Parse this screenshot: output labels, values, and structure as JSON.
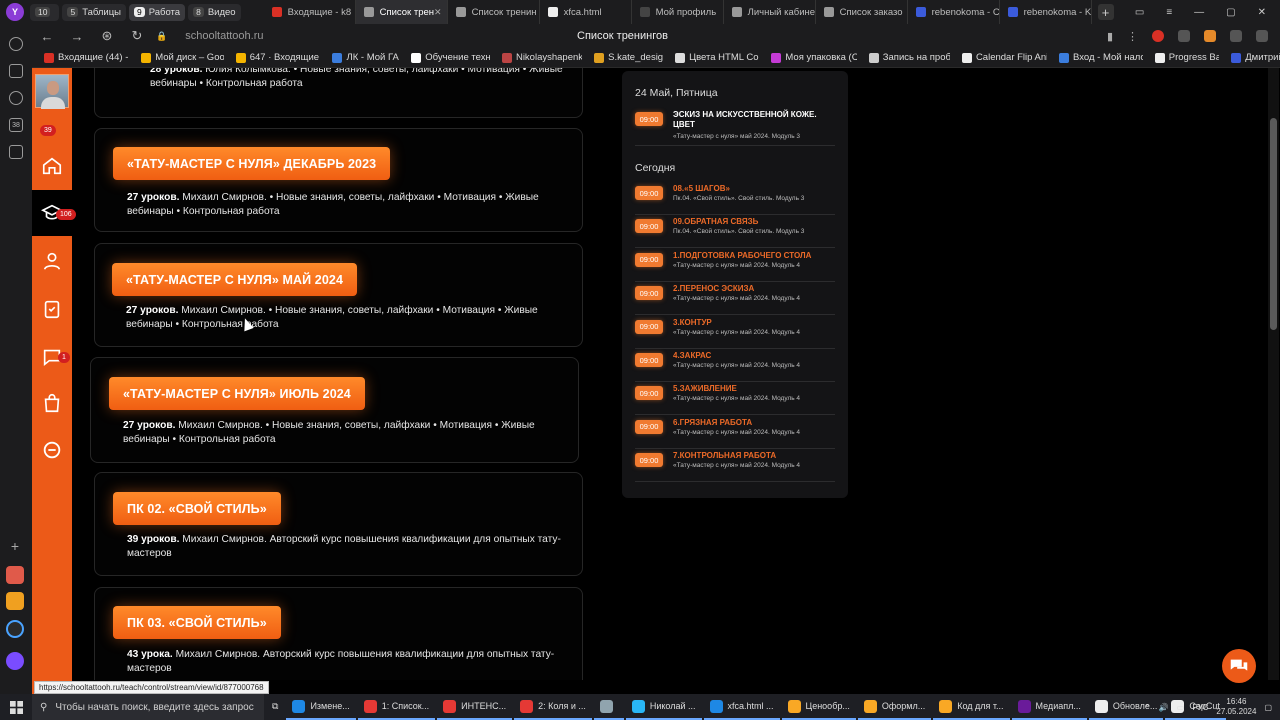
{
  "browser": {
    "tab_groups": [
      {
        "count": "10",
        "label": "Таблицы"
      },
      {
        "count": "5",
        "label": "Таблицы"
      },
      {
        "count": "9",
        "label": "Работа"
      },
      {
        "count": "8",
        "label": "Видео"
      }
    ],
    "tabs": [
      {
        "label": "Входящие - k8",
        "icon_color": "#d93025"
      },
      {
        "label": "Список трен",
        "icon_color": "#999999",
        "active": true
      },
      {
        "label": "Список тренин",
        "icon_color": "#999999"
      },
      {
        "label": "xfca.html",
        "icon_color": "#eeeeee"
      },
      {
        "label": "Мой профиль",
        "icon_color": "#444444"
      },
      {
        "label": "Личный кабине",
        "icon_color": "#999999"
      },
      {
        "label": "Список заказо",
        "icon_color": "#999999"
      },
      {
        "label": "rebenokoma - C",
        "icon_color": "#3b5bdb"
      },
      {
        "label": "rebenokoma - K",
        "icon_color": "#3b5bdb"
      }
    ],
    "url": "schooltattooh.ru",
    "page_title": "Список тренингов",
    "bookmarks": [
      {
        "label": "Входящие (44) - k",
        "color": "#d93025"
      },
      {
        "label": "Мой диск – Goog",
        "color": "#f4b400"
      },
      {
        "label": "647 · Входящие –",
        "color": "#f4b400"
      },
      {
        "label": "ЛК - Мой ГАЗ",
        "color": "#3b7ddd"
      },
      {
        "label": "Обучение техни",
        "color": "#ffffff"
      },
      {
        "label": "Nikolayshapenko",
        "color": "#bb4444"
      },
      {
        "label": "S.kate_design",
        "color": "#e0a020"
      },
      {
        "label": "Цвета HTML Colo",
        "color": "#dddddd"
      },
      {
        "label": "Моя упаковка (Сс",
        "color": "#c53bd6"
      },
      {
        "label": "Запись на пробн",
        "color": "#cccccc"
      },
      {
        "label": "Calendar Flip Anin",
        "color": "#eeeeee"
      },
      {
        "label": "Вход - Мой налог",
        "color": "#3b7ddd"
      },
      {
        "label": "Progress Bar",
        "color": "#eeeeee"
      },
      {
        "label": "Дмитрий",
        "color": "#3b5bdb"
      }
    ]
  },
  "sidebar": {
    "badges": {
      "top": "39",
      "courses": "106",
      "chat": "1"
    }
  },
  "courses": [
    {
      "title": "",
      "lessons": "28 уроков.",
      "text": "Юлия Колымкова. • Новые знания, советы, лайфхаки • Мотивация • Живые вебинары • Контрольная работа"
    },
    {
      "title": "«ТАТУ-МАСТЕР С НУЛЯ» ДЕКАБРЬ 2023",
      "lessons": "27 уроков.",
      "text": "Михаил Смирнов. • Новые знания, советы, лайфхаки • Мотивация • Живые вебинары • Контрольная работа"
    },
    {
      "title": "«ТАТУ-МАСТЕР С НУЛЯ» МАЙ 2024",
      "lessons": "27 уроков.",
      "text": "Михаил Смирнов. • Новые знания, советы, лайфхаки • Мотивация • Живые вебинары • Контрольная работа"
    },
    {
      "title": "«ТАТУ-МАСТЕР С НУЛЯ» ИЮЛЬ 2024",
      "lessons": "27 уроков.",
      "text": "Михаил Смирнов. • Новые знания, советы, лайфхаки • Мотивация • Живые вебинары • Контрольная работа"
    },
    {
      "title": "ПК 02. «СВОЙ СТИЛЬ»",
      "lessons": "39 уроков.",
      "text": "Михаил Смирнов. Авторский курс повышения квалификации для опытных тату-мастеров"
    },
    {
      "title": "ПК 03. «СВОЙ СТИЛЬ»",
      "lessons": "43 урока.",
      "text": "Михаил Смирнов. Авторский курс повышения квалификации для опытных тату-мастеров"
    }
  ],
  "schedule": {
    "day1": {
      "label": "24 Май, Пятница",
      "items": [
        {
          "time": "09:00",
          "title": "ЭСКИЗ НА ИСКУССТВЕННОЙ КОЖЕ. ЦВЕТ",
          "sub": "«Тату-мастер с нуля» май 2024. Модуль 3"
        }
      ]
    },
    "today": {
      "label": "Сегодня",
      "items": [
        {
          "time": "09:00",
          "title": "08.«5 ШАГОВ»",
          "sub": "Пк.04. «Свой стиль». Свой стиль. Модуль 3"
        },
        {
          "time": "09:00",
          "title": "09.ОБРАТНАЯ СВЯЗЬ",
          "sub": "Пк.04. «Свой стиль». Свой стиль. Модуль 3"
        },
        {
          "time": "09:00",
          "title": "1.ПОДГОТОВКА РАБОЧЕГО СТОЛА",
          "sub": "«Тату-мастер с нуля» май 2024. Модуль 4"
        },
        {
          "time": "09:00",
          "title": "2.ПЕРЕНОС ЭСКИЗА",
          "sub": "«Тату-мастер с нуля» май 2024. Модуль 4"
        },
        {
          "time": "09:00",
          "title": "3.КОНТУР",
          "sub": "«Тату-мастер с нуля» май 2024. Модуль 4"
        },
        {
          "time": "09:00",
          "title": "4.ЗАКРАС",
          "sub": "«Тату-мастер с нуля» май 2024. Модуль 4"
        },
        {
          "time": "09:00",
          "title": "5.ЗАЖИВЛЕНИЕ",
          "sub": "«Тату-мастер с нуля» май 2024. Модуль 4"
        },
        {
          "time": "09:00",
          "title": "6.ГРЯЗНАЯ РАБОТА",
          "sub": "«Тату-мастер с нуля» май 2024. Модуль 4"
        },
        {
          "time": "09:00",
          "title": "7.КОНТРОЛЬНАЯ РАБОТА",
          "sub": "«Тату-мастер с нуля» май 2024. Модуль 4"
        }
      ]
    }
  },
  "status_url": "https://schooltattooh.ru/teach/control/stream/view/id/877000768",
  "taskbar": {
    "search_placeholder": "Чтобы начать поиск, введите здесь запрос",
    "apps": [
      {
        "label": "Измене...",
        "color": "#1e88e5"
      },
      {
        "label": "1: Список...",
        "color": "#e53935"
      },
      {
        "label": "ИНТЕНС...",
        "color": "#e53935"
      },
      {
        "label": "2: Коля и ...",
        "color": "#e53935"
      },
      {
        "label": "",
        "color": "#90a4ae"
      },
      {
        "label": "Николай ...",
        "color": "#29b6f6"
      },
      {
        "label": "xfca.html ...",
        "color": "#1e88e5"
      },
      {
        "label": "Ценообр...",
        "color": "#f9a825"
      },
      {
        "label": "Оформл...",
        "color": "#f9a825"
      },
      {
        "label": "Код для т...",
        "color": "#f9a825"
      },
      {
        "label": "Медиапл...",
        "color": "#6a1b9a"
      },
      {
        "label": "Обновле...",
        "color": "#eeeeee"
      },
      {
        "label": "CapCut",
        "color": "#eeeeee"
      }
    ],
    "lang": "РУС",
    "time": "16:46",
    "date": "27.05.2024"
  },
  "colors": {
    "accent": "#ec5a18",
    "card_bg": "#030303",
    "schedule_bg": "#141416"
  }
}
